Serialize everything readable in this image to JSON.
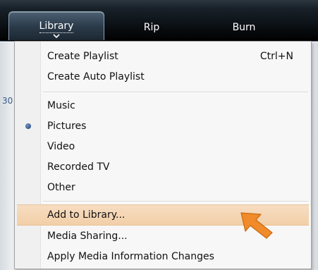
{
  "toolbar": {
    "tabs": [
      {
        "label": "Library"
      },
      {
        "label": "Rip"
      },
      {
        "label": "Burn"
      }
    ]
  },
  "background": {
    "stray_text": "30"
  },
  "menu": {
    "items": [
      {
        "label": "Create Playlist",
        "shortcut": "Ctrl+N"
      },
      {
        "label": "Create Auto Playlist"
      },
      {
        "label": "Music"
      },
      {
        "label": "Pictures",
        "selected": true
      },
      {
        "label": "Video"
      },
      {
        "label": "Recorded TV"
      },
      {
        "label": "Other"
      },
      {
        "label": "Add to Library...",
        "highlighted": true
      },
      {
        "label": "Media Sharing..."
      },
      {
        "label": "Apply Media Information Changes"
      }
    ]
  },
  "colors": {
    "toolbar": "#0d1318",
    "menu_background": "#f7f7f7",
    "highlight": "#f2cfa8",
    "pointer_arrow": "#f08a2a"
  },
  "icons": {
    "radio": "radio-selected-icon",
    "chevron": "chevron-down-icon",
    "pointer": "arrow-pointer-icon"
  }
}
